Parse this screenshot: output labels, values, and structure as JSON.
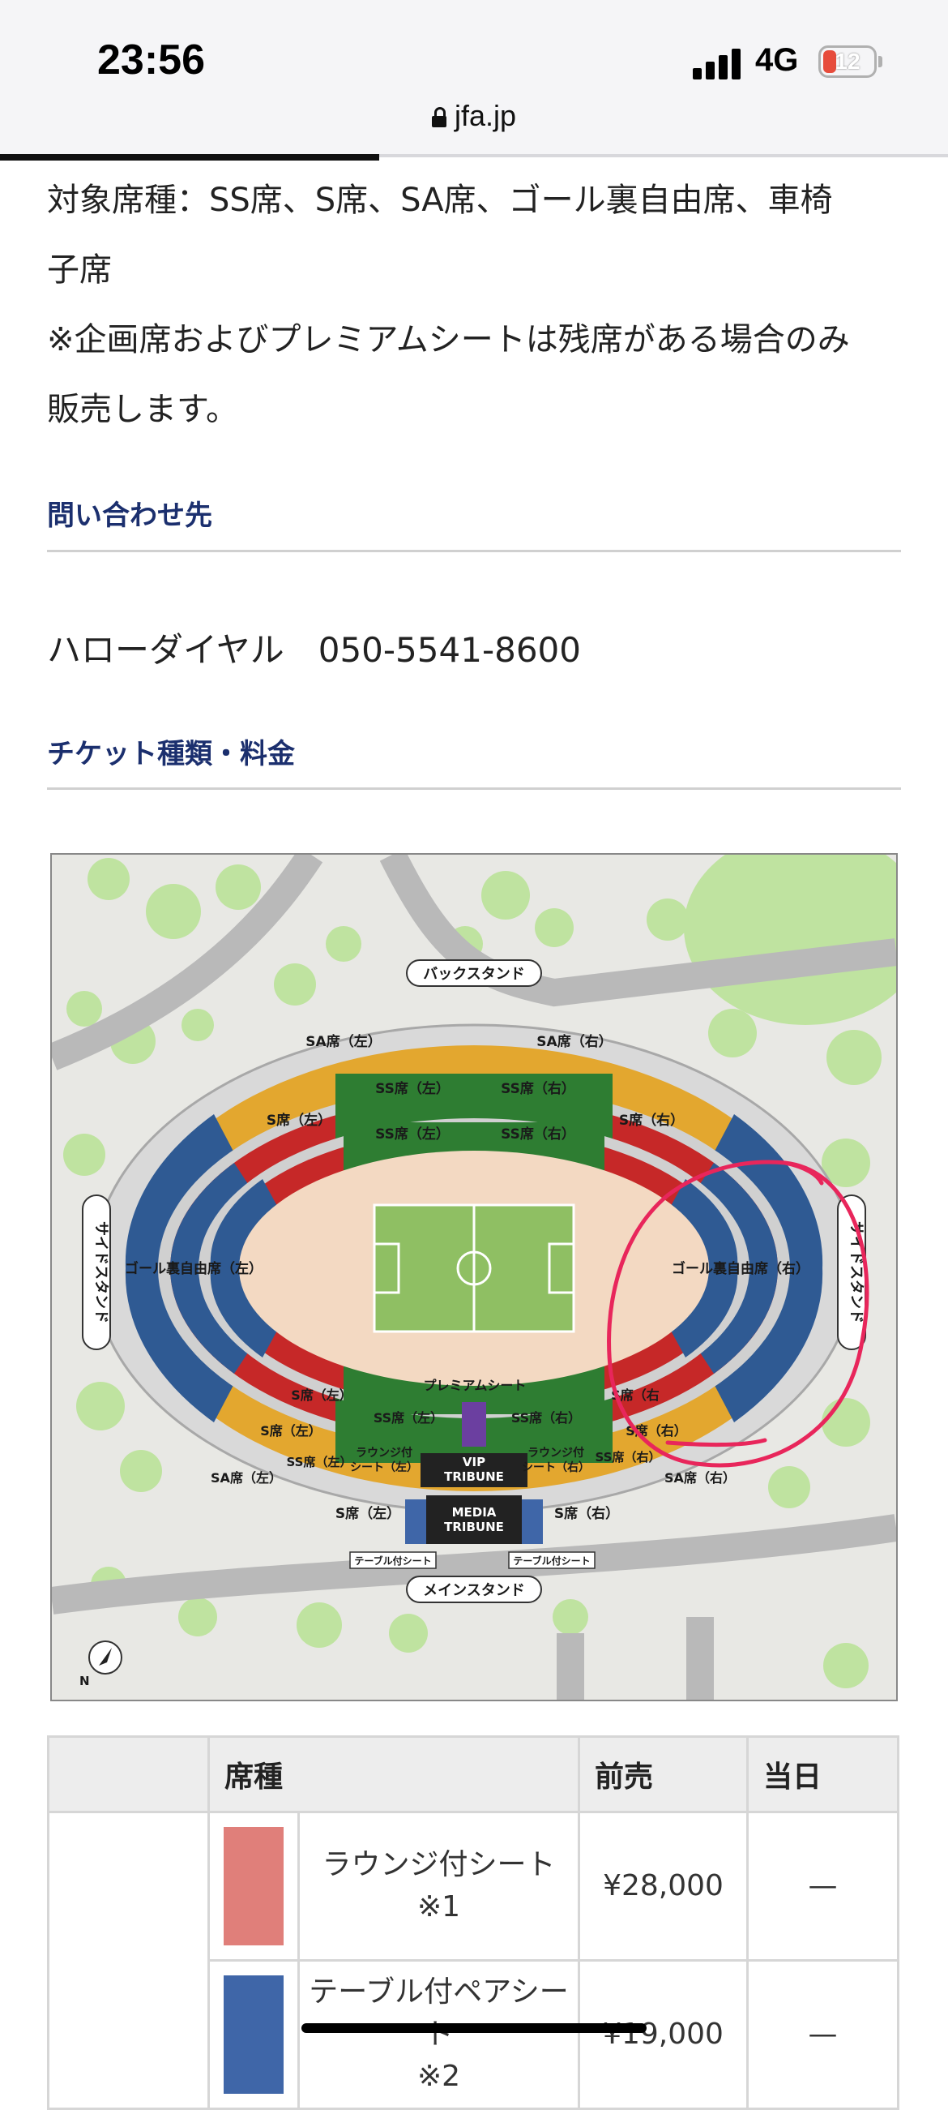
{
  "status_bar": {
    "time": "23:56",
    "network": "4G",
    "battery": "12"
  },
  "browser": {
    "url": "jfa.jp"
  },
  "content": {
    "seat_types_line1": "対象席種：SS席、S席、SA席、ゴール裏自由席、車椅",
    "seat_types_line2": "子席",
    "note_line1": "※企画席およびプレミアムシートは残席がある場合のみ",
    "note_line2": "販売します。",
    "contact_heading": "問い合わせ先",
    "contact_text": "ハローダイヤル　050-5541-8600",
    "tickets_heading": "チケット種類・料金"
  },
  "map": {
    "back_stand": "バックスタンド",
    "main_stand": "メインスタンド",
    "side_stand": "サイドスタンド",
    "sa_left": "SA席（左）",
    "sa_right": "SA席（右）",
    "ss_left": "SS席（左）",
    "ss_right": "SS席（右）",
    "s_left": "S席（左）",
    "s_right": "S席（右）",
    "s_right_cut": "S席（右",
    "goal_left": "ゴール裏自由席（左）",
    "goal_right": "ゴール裏自由席（右）",
    "premium": "プレミアムシート",
    "lounge_left_1": "ラウンジ付",
    "lounge_left_2": "シート（左）",
    "lounge_right_1": "ラウンジ付",
    "lounge_right_2": "シート（右）",
    "vip_1": "VIP",
    "vip_2": "TRIBUNE",
    "media_1": "MEDIA",
    "media_2": "TRIBUNE",
    "table_seat": "テーブル付シート",
    "north": "N",
    "colors": {
      "sa": "#e3a72f",
      "ss": "#2e7d32",
      "s": "#c62828",
      "goal": "#2f5a93",
      "field": "#8fbf63",
      "track": "#f3d9c2",
      "annotation": "#e8265b"
    }
  },
  "price_table": {
    "headers": [
      "",
      "席種",
      "前売",
      "当日"
    ],
    "rows": [
      {
        "color": "#e07f7a",
        "name_line1": "ラウンジ付シート",
        "name_line2": "※1",
        "advance": "¥28,000",
        "day": "—"
      },
      {
        "color": "#3f66a8",
        "name_line1": "テーブル付ペアシート",
        "name_line2": "※2",
        "advance": "¥19,000",
        "day": "—"
      }
    ]
  }
}
